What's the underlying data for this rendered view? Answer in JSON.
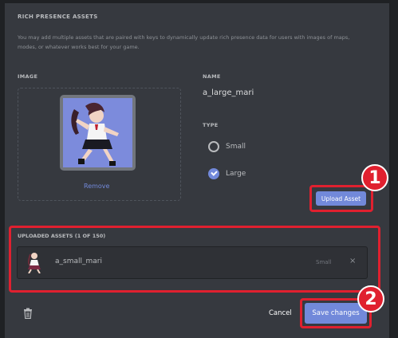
{
  "section": {
    "title": "RICH PRESENCE ASSETS",
    "description": "You may add multiple assets that are paired with keys to dynamically update rich presence data for users with images of maps, modes, or whatever works best for your game."
  },
  "image": {
    "label": "IMAGE",
    "remove_label": "Remove"
  },
  "name": {
    "label": "NAME",
    "value": "a_large_mari"
  },
  "type": {
    "label": "TYPE",
    "options": [
      {
        "label": "Small",
        "selected": false
      },
      {
        "label": "Large",
        "selected": true
      }
    ]
  },
  "upload_button": "Upload Asset",
  "uploaded": {
    "title": "UPLOADED ASSETS (1 OF 150)",
    "items": [
      {
        "name": "a_small_mari",
        "type": "Small",
        "remove": "×"
      }
    ]
  },
  "footer": {
    "cancel": "Cancel",
    "save": "Save changes"
  },
  "annotations": {
    "badge1": "1",
    "badge2": "2"
  },
  "colors": {
    "accent": "#7289da",
    "highlight": "#e0202f"
  }
}
